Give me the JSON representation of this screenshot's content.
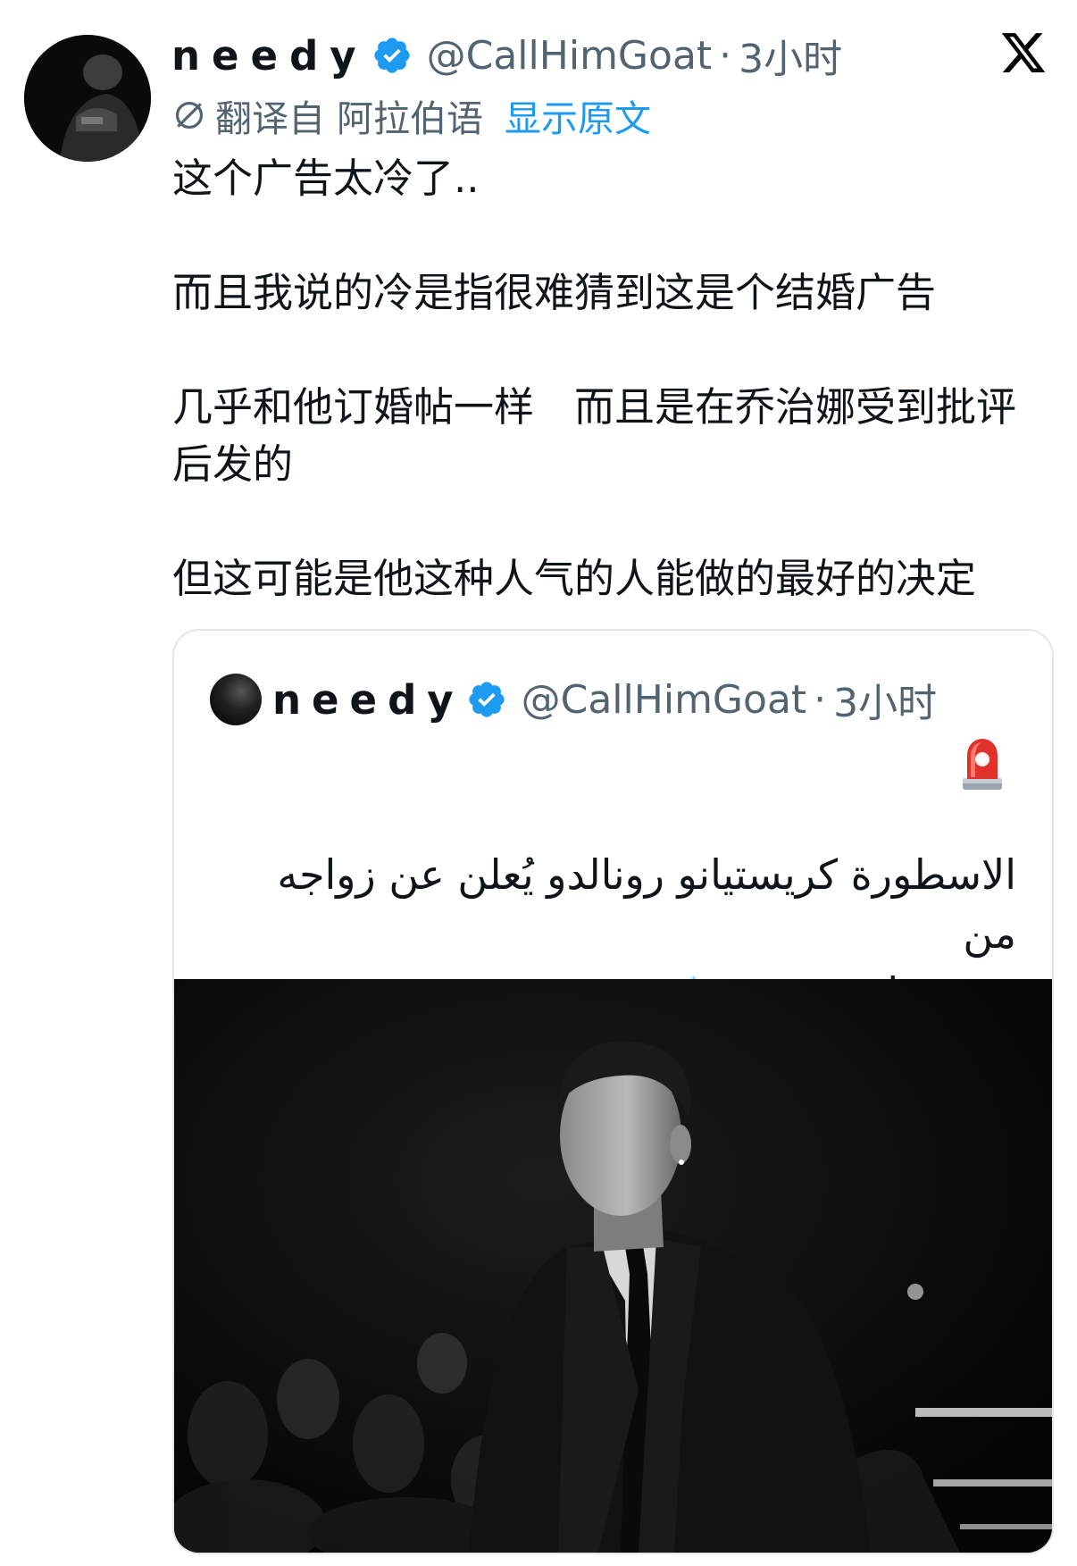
{
  "tweet": {
    "display_name": "needy",
    "handle": "@CallHimGoat",
    "separator": "·",
    "time": "3小时",
    "translated_from": "翻译自 阿拉伯语",
    "show_original": "显示原文",
    "paragraphs": [
      "这个广告太冷了..",
      "而且我说的冷是指很难猜到这是个结婚广告",
      "几乎和他订婚帖一样　而且是在乔治娜受到批评后发的",
      "但这可能是他这种人气的人能做的最好的决定"
    ]
  },
  "quoted_tweet": {
    "display_name": "needy",
    "handle": "@CallHimGoat",
    "separator": "·",
    "time": "3小时",
    "text_line1": "الاسطورة كريستيانو رونالدو يُعلن عن زواجه من",
    "text_line2": "جورجينا رودريغيز"
  },
  "icons": {
    "verified": "verified-badge-icon",
    "close": "x-logo-icon",
    "translate": "globe-slash-icon",
    "siren": "rotating-light-emoji",
    "ring": "ring-emoji"
  },
  "colors": {
    "link": "#1d9bf0",
    "secondary_text": "#536471",
    "primary_text": "#0f1419",
    "verified": "#1d9bf0"
  }
}
